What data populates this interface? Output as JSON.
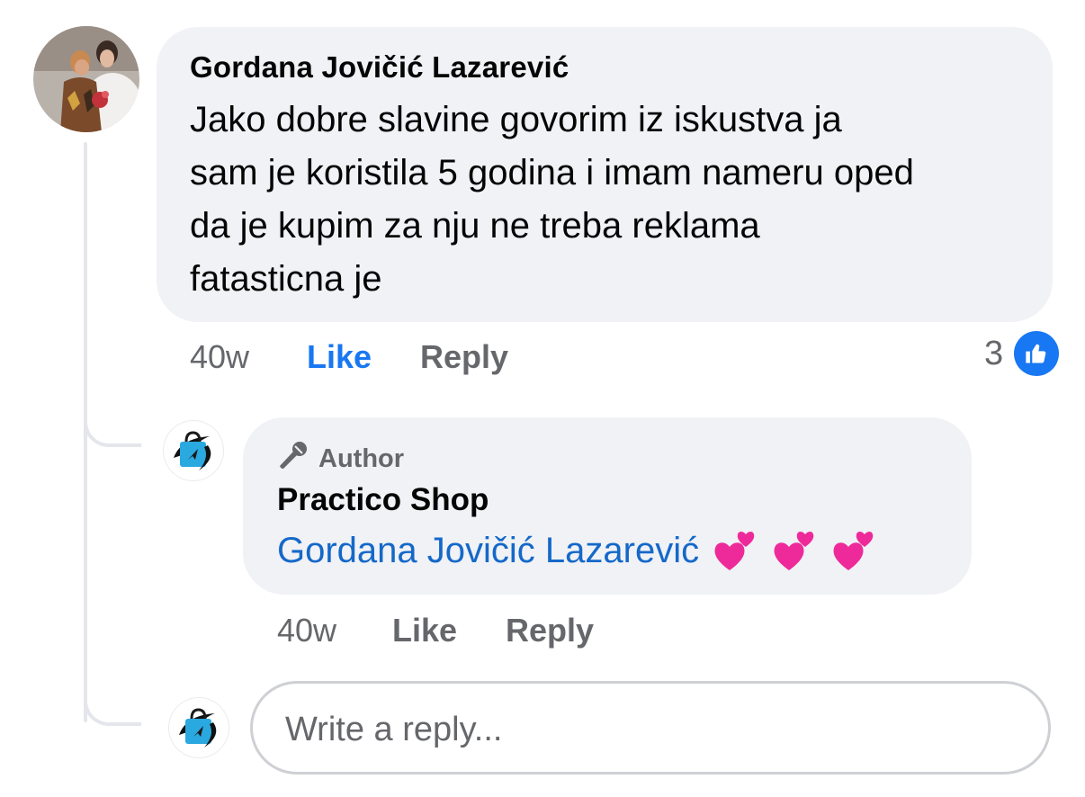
{
  "colors": {
    "bubble": "#f0f2f5",
    "like_blue": "#1877f2",
    "mention_blue": "#1568c9",
    "muted_text": "#65676b"
  },
  "comment": {
    "author": "Gordana Jovičić Lazarević",
    "lines": [
      "Jako dobre slavine govorim iz iskustva  ja",
      "sam je koristila 5 godina i imam nameru oped",
      "da je kupim za nju ne treba reklama",
      "fatasticna je"
    ],
    "time": "40w",
    "like_label": "Like",
    "reply_label": "Reply",
    "reaction_count": "3",
    "reaction_icon": "thumbs-up-icon"
  },
  "reply": {
    "badge_icon": "microphone-icon",
    "badge_label": "Author",
    "author": "Practico Shop",
    "mention": "Gordana Jovičić Lazarević",
    "emojis": [
      "💕",
      "💕",
      "💕"
    ],
    "time": "40w",
    "like_label": "Like",
    "reply_label": "Reply"
  },
  "composer": {
    "placeholder": "Write a reply..."
  }
}
